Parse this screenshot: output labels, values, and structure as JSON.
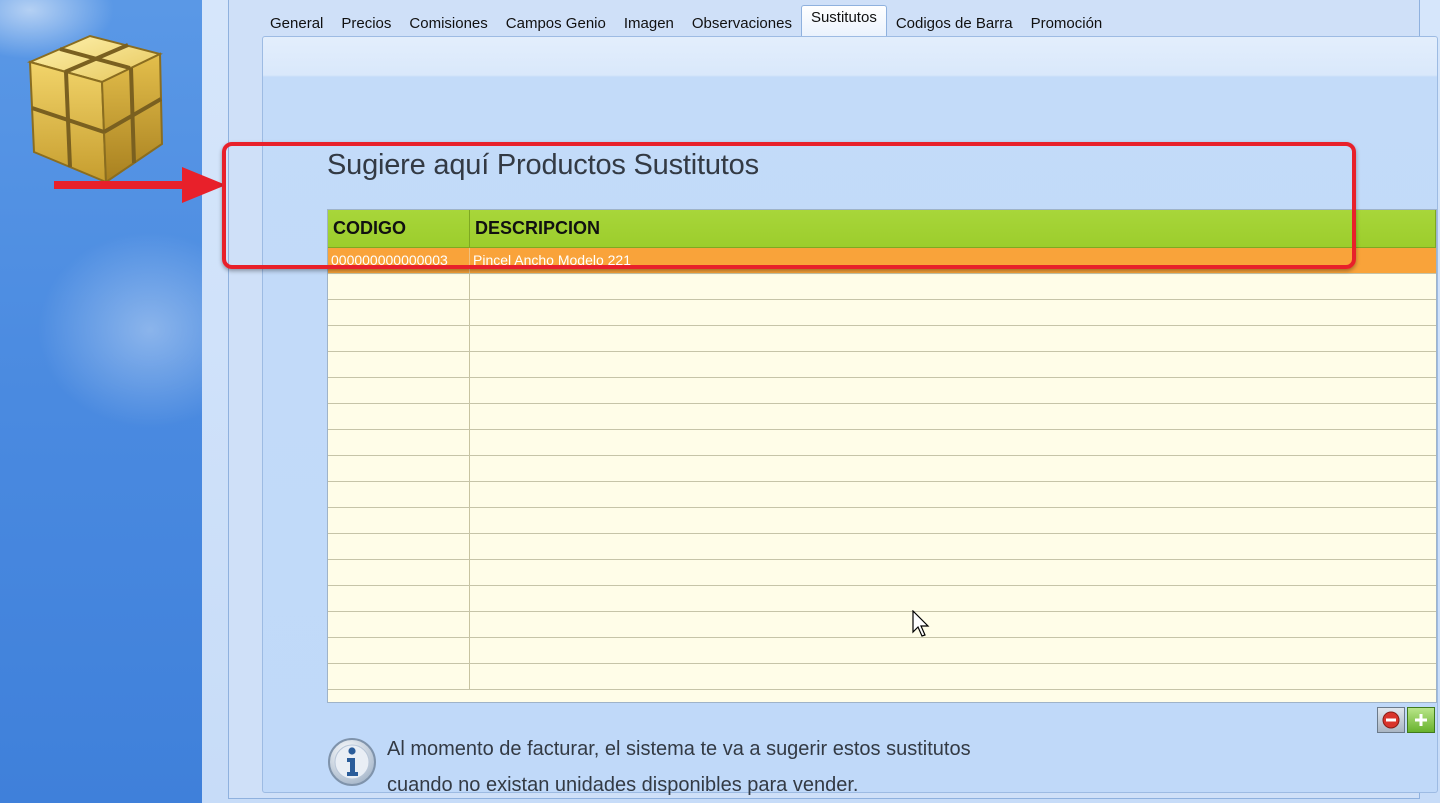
{
  "tabs": [
    {
      "label": "General",
      "active": false
    },
    {
      "label": "Precios",
      "active": false
    },
    {
      "label": "Comisiones",
      "active": false
    },
    {
      "label": "Campos Genio",
      "active": false
    },
    {
      "label": "Imagen",
      "active": false
    },
    {
      "label": "Observaciones",
      "active": false
    },
    {
      "label": "Sustitutos",
      "active": true
    },
    {
      "label": "Codigos de Barra",
      "active": false
    },
    {
      "label": "Promoción",
      "active": false
    }
  ],
  "panel": {
    "title": "Sugiere aquí Productos Sustitutos"
  },
  "grid": {
    "columns": [
      "CODIGO",
      "DESCRIPCION"
    ],
    "rows": [
      {
        "codigo": "000000000000003",
        "descripcion": "Pincel Ancho Modelo 221",
        "selected": true
      }
    ]
  },
  "info": {
    "line1": "Al momento de facturar, el sistema te va a sugerir estos sustitutos",
    "line2": "cuando no existan unidades disponibles para vender."
  },
  "colors": {
    "header_green": "#9ccd2c",
    "selected_orange": "#f9a33a",
    "grid_bg": "#fffde8",
    "highlight_red": "#e8202a"
  },
  "icons": {
    "app": "yellow-cube-icon",
    "remove": "minus-icon",
    "add": "plus-icon",
    "info": "info-icon"
  }
}
